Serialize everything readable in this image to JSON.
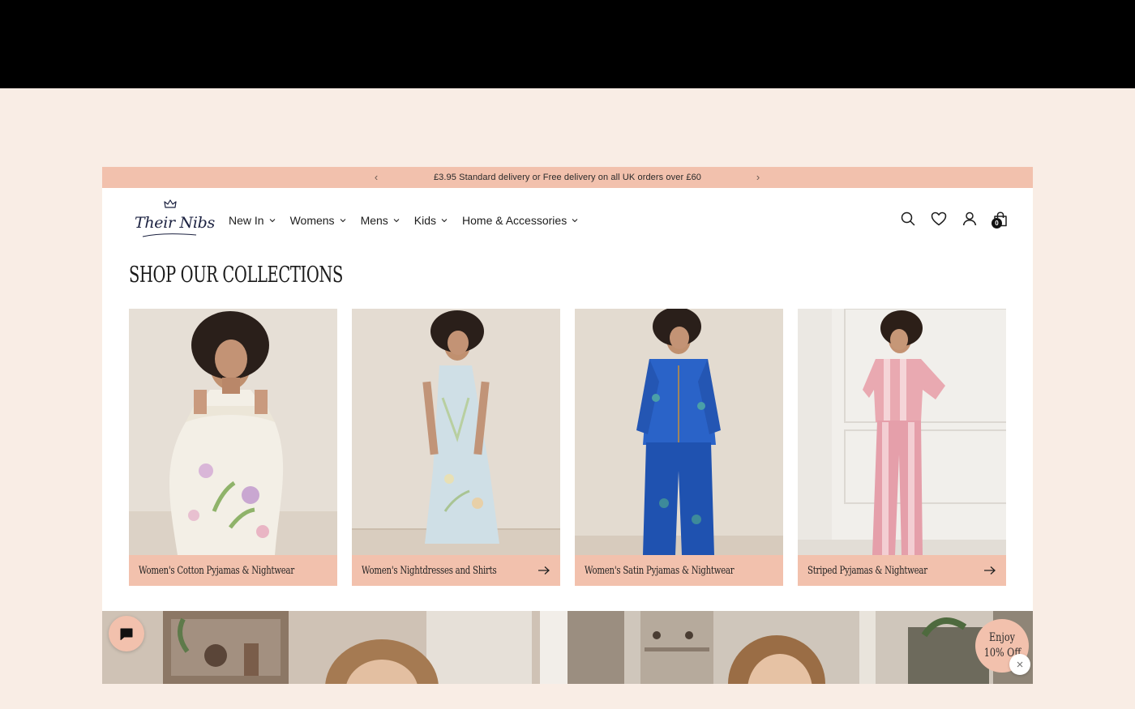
{
  "announcement": {
    "prev_icon": "chevron-left-icon",
    "message": "£3.95 Standard delivery or Free delivery on all UK orders over £60",
    "next_icon": "chevron-right-icon"
  },
  "brand": {
    "name": "Their Nibs",
    "logo_icon": "crown-icon"
  },
  "nav": {
    "items": [
      {
        "label": "New In"
      },
      {
        "label": "Womens"
      },
      {
        "label": "Mens"
      },
      {
        "label": "Kids"
      },
      {
        "label": "Home & Accessories"
      }
    ]
  },
  "header_icons": {
    "search": "search-icon",
    "wishlist": "heart-icon",
    "account": "user-icon",
    "cart": "bag-icon",
    "cart_count": "0"
  },
  "collections": {
    "title": "SHOP OUR COLLECTIONS",
    "cards": [
      {
        "label": "Women's Cotton Pyjamas & Nightwear"
      },
      {
        "label": "Women's Nightdresses and Shirts"
      },
      {
        "label": "Women's Satin Pyjamas & Nightwear"
      },
      {
        "label": "Striped Pyjamas & Nightwear"
      }
    ]
  },
  "widgets": {
    "chat_icon": "chat-icon",
    "promo_line1": "Enjoy",
    "promo_line2": "10% Off",
    "close_icon": "close-icon"
  },
  "colors": {
    "accent": "#f2c1ad",
    "page_bg": "#f9ede5",
    "text": "#1d1d1d"
  }
}
